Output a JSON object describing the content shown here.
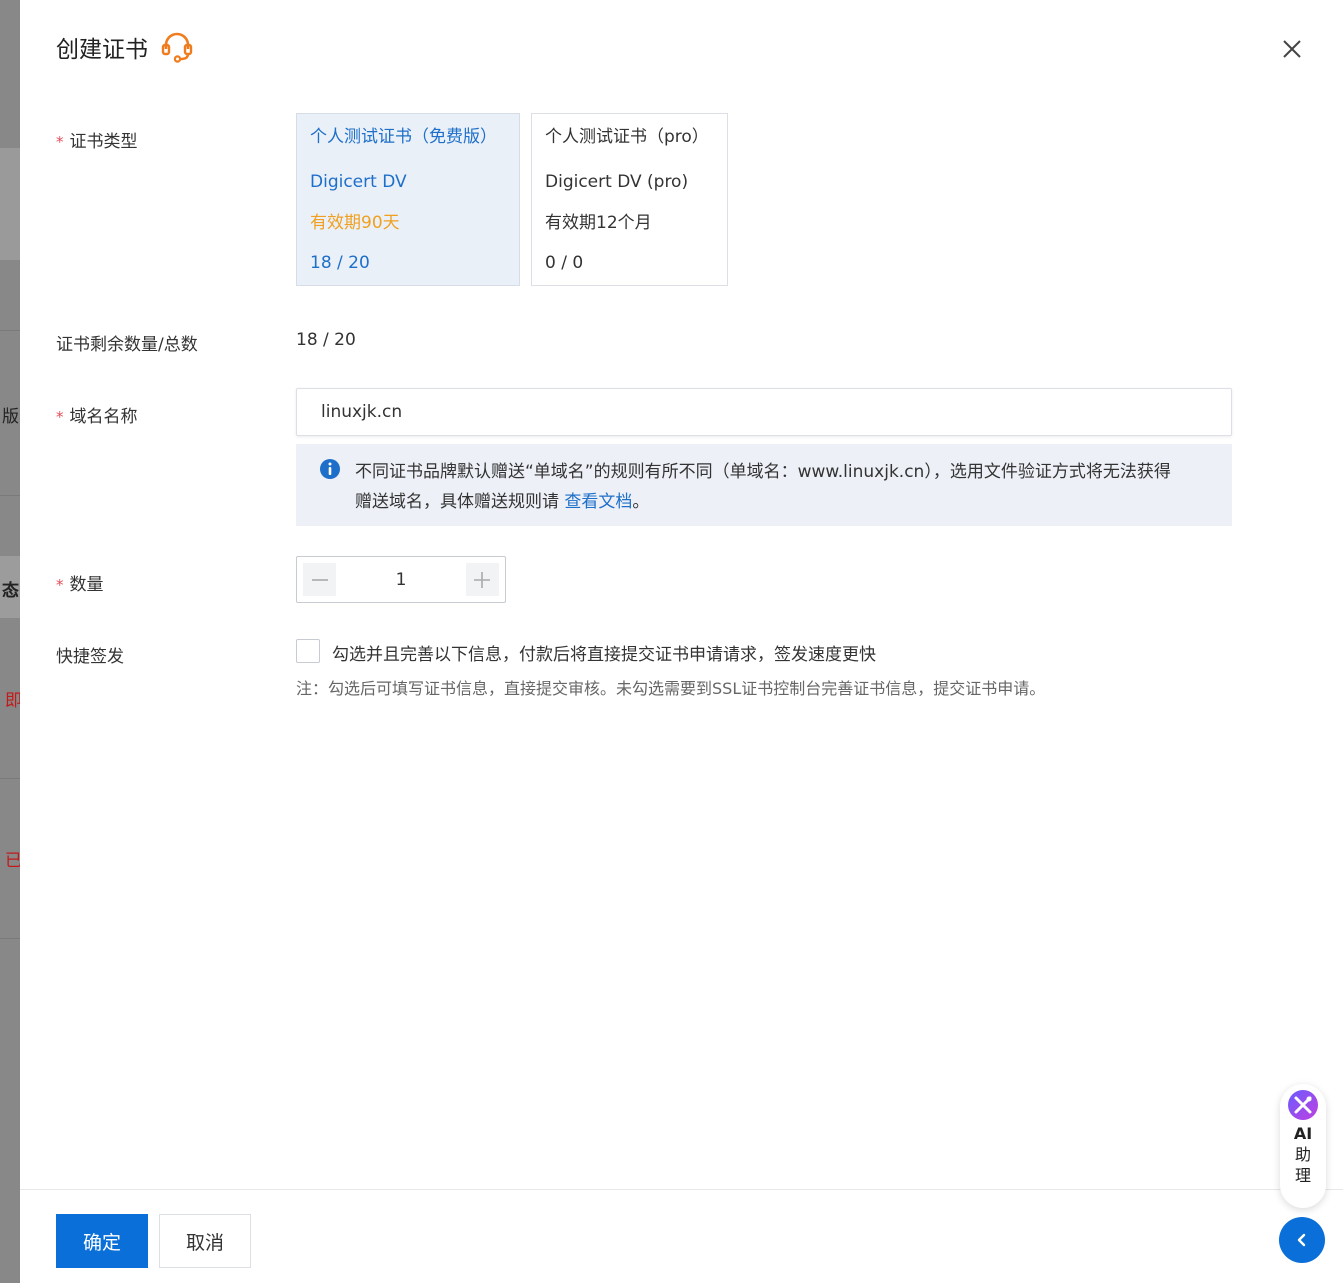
{
  "background": {
    "fragments": [
      "版",
      "态",
      "即",
      "已"
    ]
  },
  "header": {
    "title": "创建证书"
  },
  "form": {
    "cert_type": {
      "label": "证书类型",
      "options": [
        {
          "title": "个人测试证书（免费版）",
          "brand": "Digicert DV",
          "validity": "有效期90天",
          "count": "18 / 20",
          "selected": true
        },
        {
          "title": "个人测试证书（pro）",
          "brand": "Digicert DV (pro)",
          "validity": "有效期12个月",
          "count": "0 / 0",
          "selected": false
        }
      ]
    },
    "remaining": {
      "label": "证书剩余数量/总数",
      "value": "18 / 20"
    },
    "domain": {
      "label": "域名名称",
      "value": "linuxjk.cn",
      "notice_line1": "不同证书品牌默认赠送“单域名”的规则有所不同（单域名：www.linuxjk.cn），选用文件验证方式将无法获得",
      "notice_line2": "赠送域名，具体赠送规则请 ",
      "notice_link": "查看文档",
      "notice_end": "。"
    },
    "quantity": {
      "label": "数量",
      "value": "1"
    },
    "quick_issue": {
      "label": "快捷签发",
      "checkbox_text": "勾选并且完善以下信息，付款后将直接提交证书申请请求，签发速度更快",
      "note": "注：勾选后可填写证书信息，直接提交审核。未勾选需要到SSL证书控制台完善证书信息，提交证书申请。"
    }
  },
  "footer": {
    "confirm_label": "确定",
    "cancel_label": "取消"
  },
  "ai_assistant": {
    "label_en": "AI",
    "label_zh1": "助",
    "label_zh2": "理"
  },
  "colors": {
    "primary": "#0a6fd8",
    "link": "#1e6fc9",
    "warning": "#f0a020",
    "required": "#e34d59",
    "headset": "#f07c1e"
  }
}
